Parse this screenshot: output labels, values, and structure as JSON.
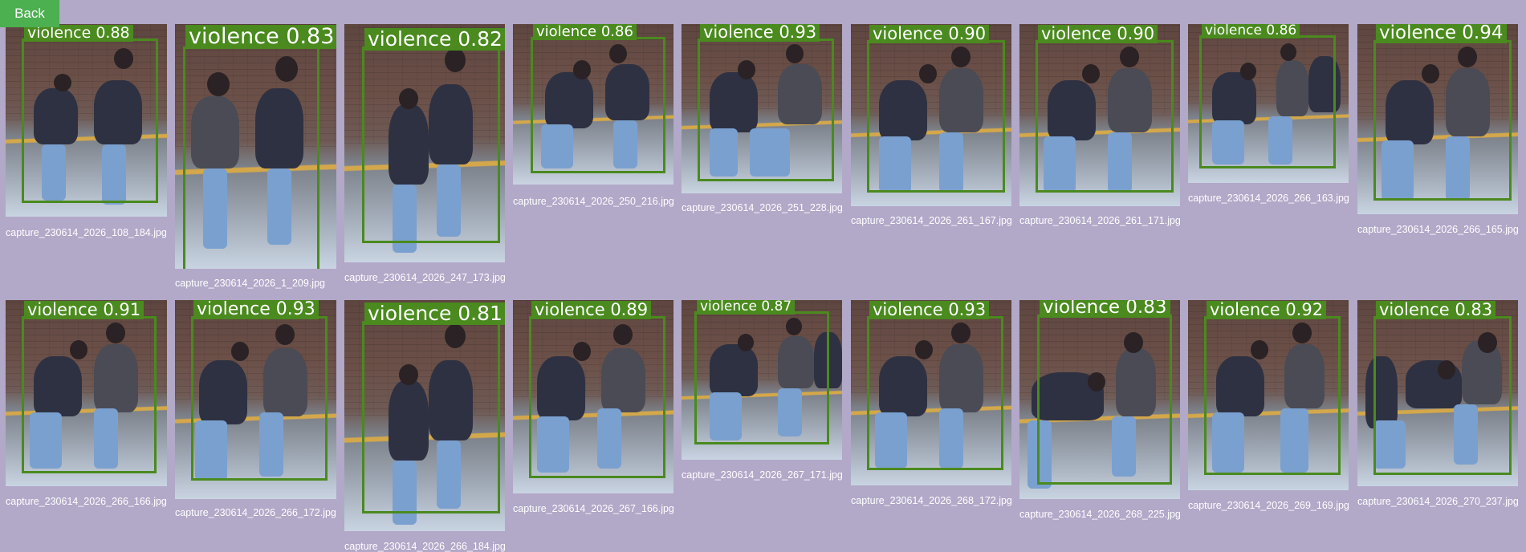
{
  "back_button": {
    "label": "Back"
  },
  "colors": {
    "background": "#b2a8c8",
    "back_button": "#4caf50",
    "detection_box": "#4a8a1e",
    "caption_text": "#ffffff"
  },
  "rows": [
    {
      "items": [
        {
          "label": "violence 0.88",
          "filename": "capture_230614_2026_108_184.jpg"
        },
        {
          "label": "violence 0.83",
          "filename": "capture_230614_2026_1_209.jpg"
        },
        {
          "label": "violence 0.82",
          "filename": "capture_230614_2026_247_173.jpg"
        },
        {
          "label": "violence 0.86",
          "filename": "capture_230614_2026_250_216.jpg"
        },
        {
          "label": "violence 0.93",
          "filename": "capture_230614_2026_251_228.jpg"
        },
        {
          "label": "violence 0.90",
          "filename": "capture_230614_2026_261_167.jpg"
        },
        {
          "label": "violence 0.90",
          "filename": "capture_230614_2026_261_171.jpg"
        },
        {
          "label": "violence 0.86",
          "filename": "capture_230614_2026_266_163.jpg"
        },
        {
          "label": "violence 0.94",
          "filename": "capture_230614_2026_266_165.jpg"
        }
      ]
    },
    {
      "items": [
        {
          "label": "violence 0.91",
          "filename": "capture_230614_2026_266_166.jpg"
        },
        {
          "label": "violence 0.93",
          "filename": "capture_230614_2026_266_172.jpg"
        },
        {
          "label": "violence 0.81",
          "filename": "capture_230614_2026_266_184.jpg"
        },
        {
          "label": "violence 0.89",
          "filename": "capture_230614_2026_267_166.jpg"
        },
        {
          "label": "violence 0.87",
          "filename": "capture_230614_2026_267_171.jpg"
        },
        {
          "label": "violence 0.93",
          "filename": "capture_230614_2026_268_172.jpg"
        },
        {
          "label": "violence 0.83",
          "filename": "capture_230614_2026_268_225.jpg"
        },
        {
          "label": "violence 0.92",
          "filename": "capture_230614_2026_269_169.jpg"
        },
        {
          "label": "violence 0.83",
          "filename": "capture_230614_2026_270_237.jpg"
        }
      ]
    }
  ]
}
